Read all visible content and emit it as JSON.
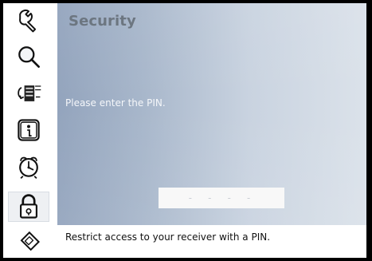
{
  "header": {
    "title": "Security"
  },
  "sidebar": {
    "items": [
      {
        "icon": "wrench-icon"
      },
      {
        "icon": "search-icon"
      },
      {
        "icon": "channel-list-icon"
      },
      {
        "icon": "info-icon"
      },
      {
        "icon": "alarm-clock-icon"
      },
      {
        "icon": "lock-icon",
        "active": true
      },
      {
        "icon": "card-icon"
      }
    ]
  },
  "main": {
    "prompt": "Please enter the PIN.",
    "pin": {
      "value": "- - - -"
    }
  },
  "footer": {
    "help_text": "Restrict access to your receiver with a PIN."
  }
}
